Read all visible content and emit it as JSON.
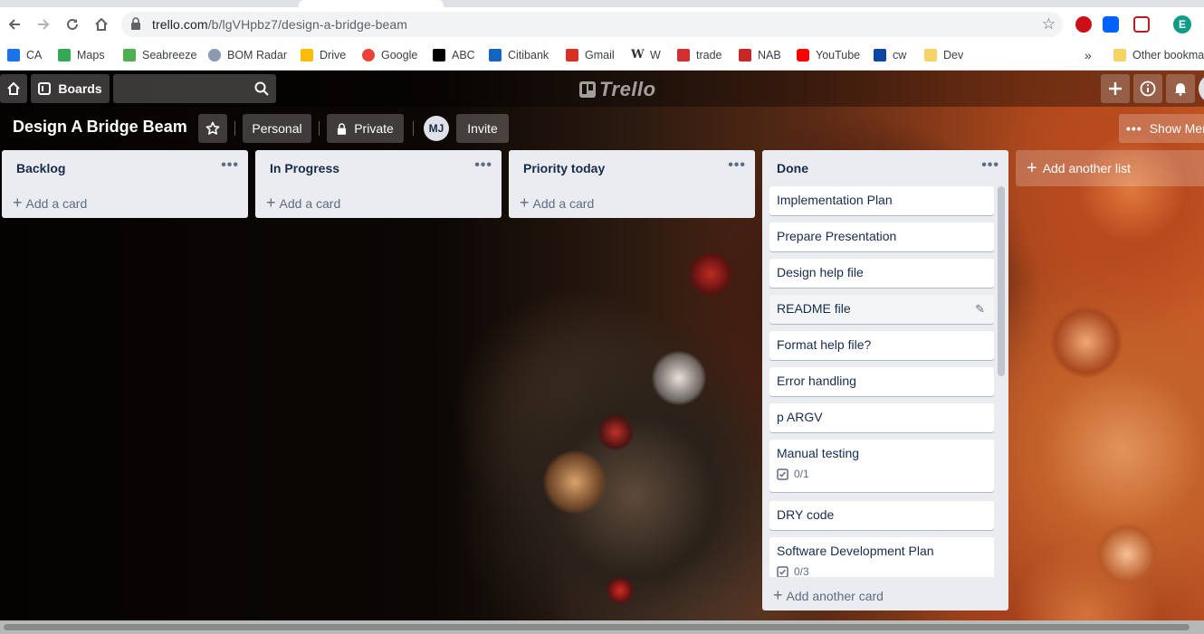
{
  "browser": {
    "url_host": "trello.com",
    "url_path": "/b/lgVHpbz7/design-a-bridge-beam",
    "profile_initial": "E",
    "bookmarks": [
      {
        "label": "CA",
        "icon": "ca-icon",
        "color": "#1a73e8"
      },
      {
        "label": "Maps",
        "icon": "maps-icon",
        "color": "#34a853"
      },
      {
        "label": "Seabreeze",
        "icon": "seabreeze-icon",
        "color": "#4caf50"
      },
      {
        "label": "BOM Radar",
        "icon": "bom-radar-icon",
        "color": "#8a9bb0"
      },
      {
        "label": "Drive",
        "icon": "drive-icon",
        "color": "#fbbc04"
      },
      {
        "label": "Google",
        "icon": "google-icon",
        "color": "#ea4335"
      },
      {
        "label": "ABC",
        "icon": "abc-icon",
        "color": "#000000"
      },
      {
        "label": "Citibank",
        "icon": "citibank-icon",
        "color": "#1565c0"
      },
      {
        "label": "Gmail",
        "icon": "gmail-icon",
        "color": "#d93025"
      },
      {
        "label": "W",
        "icon": "wikipedia-icon",
        "color": "#333333"
      },
      {
        "label": "trade",
        "icon": "trade-icon",
        "color": "#d32f2f"
      },
      {
        "label": "NAB",
        "icon": "nab-icon",
        "color": "#c62828"
      },
      {
        "label": "YouTube",
        "icon": "youtube-icon",
        "color": "#ff0000"
      },
      {
        "label": "cw",
        "icon": "cw-icon",
        "color": "#0d47a1"
      },
      {
        "label": "Dev",
        "icon": "folder-icon",
        "color": "#f6d365"
      }
    ],
    "more_bookmarks": "»",
    "other_bookmarks": "Other bookmarks"
  },
  "header": {
    "boards_label": "Boards",
    "logo_text": "Trello"
  },
  "board": {
    "name": "Design A Bridge Beam",
    "personal_label": "Personal",
    "private_label": "Private",
    "member_initials": "MJ",
    "invite_label": "Invite",
    "show_menu_label": "Show Menu"
  },
  "lists": [
    {
      "title": "Backlog",
      "add_card": "Add a card"
    },
    {
      "title": "In Progress",
      "add_card": "Add a card"
    },
    {
      "title": "Priority today",
      "add_card": "Add a card"
    },
    {
      "title": "Done",
      "add_card": "Add another card",
      "cards": [
        {
          "title": "Implementation Plan"
        },
        {
          "title": "Prepare Presentation"
        },
        {
          "title": "Design help file"
        },
        {
          "title": "README file"
        },
        {
          "title": "Format help file?"
        },
        {
          "title": "Error handling"
        },
        {
          "title": "p ARGV"
        },
        {
          "title": "Manual testing",
          "checklist": "0/1"
        },
        {
          "title": "DRY code"
        },
        {
          "title": "Software Development Plan",
          "checklist": "0/3"
        }
      ]
    }
  ],
  "add_list_label": "Add another list"
}
